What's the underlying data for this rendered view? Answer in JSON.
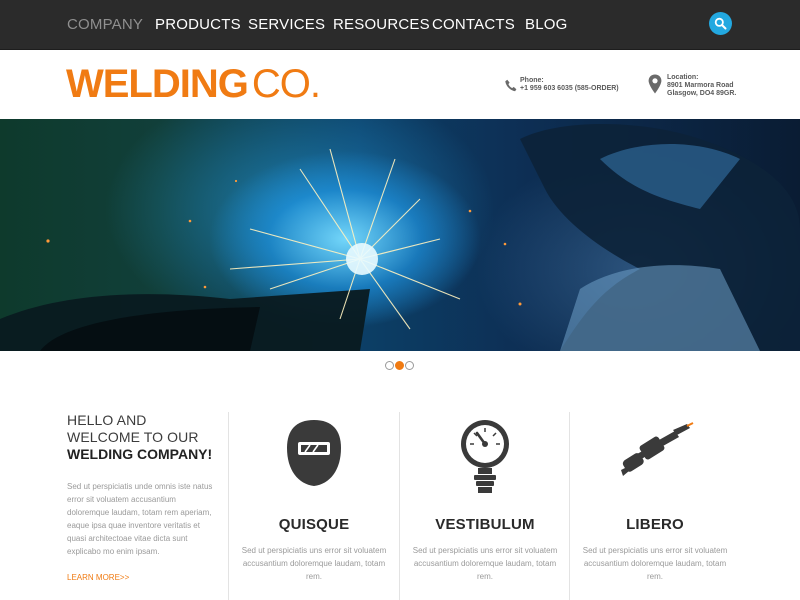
{
  "nav": {
    "items": [
      {
        "label": "COMPANY",
        "active": true
      },
      {
        "label": "PRODUCTS",
        "active": false
      },
      {
        "label": "SERVICES",
        "active": false
      },
      {
        "label": "RESOURCES",
        "active": false
      },
      {
        "label": "CONTACTS",
        "active": false
      },
      {
        "label": "BLOG",
        "active": false
      }
    ],
    "search_icon": "search-icon"
  },
  "header": {
    "logo_strong": "WELDING",
    "logo_light": "CO.",
    "phone_label": "Phone:",
    "phone_value": "+1 959 603 6035 (585-ORDER)",
    "location_label": "Location:",
    "location_line1": "8901 Marmora Road",
    "location_line2": "Glasgow, DO4 89GR."
  },
  "slider": {
    "dots": 3,
    "active_dot": 2
  },
  "intro": {
    "hello_line1": "HELLO AND",
    "hello_line2": "WELCOME TO OUR",
    "hello_strong": "WELDING COMPANY!",
    "body": "Sed ut perspiciatis unde omnis iste natus error sit voluatem accusantium doloremque laudam, totam rem aperiam, eaque ipsa quae inventore veritatis et quasi architectoae vitae dicta sunt explicabo mo enim ipsam.",
    "learn_more": "LEARN MORE>>"
  },
  "features": [
    {
      "icon": "welding-mask-icon",
      "title": "QUISQUE",
      "text": "Sed ut perspiciatis uns error sit voluatem accusantium doloremque laudam, totam rem."
    },
    {
      "icon": "pressure-gauge-icon",
      "title": "VESTIBULUM",
      "text": "Sed ut perspiciatis uns error sit voluatem accusantium doloremque laudam, totam rem."
    },
    {
      "icon": "welding-torch-icon",
      "title": "LIBERO",
      "text": "Sed ut perspiciatis uns error sit voluatem accusantium doloremque laudam, totam rem."
    }
  ],
  "colors": {
    "accent": "#f07b13",
    "nav_bg": "#2b2b2b",
    "search_bg": "#23a8e0",
    "body_text": "#9a9a9a"
  }
}
